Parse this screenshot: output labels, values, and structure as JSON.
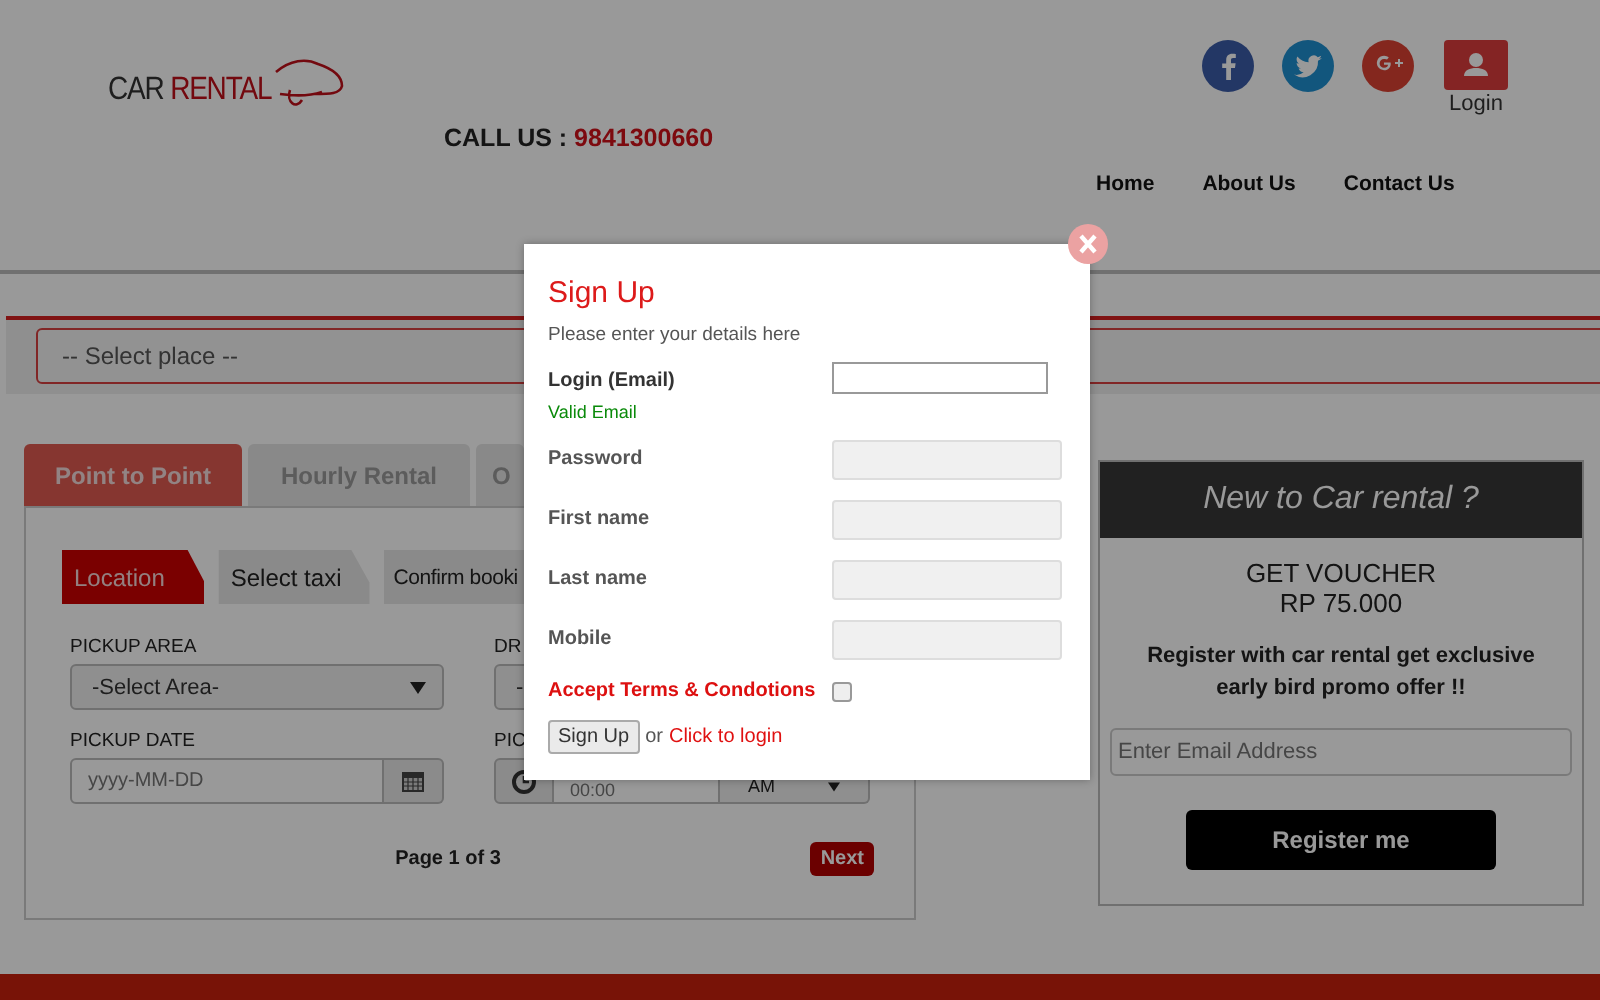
{
  "header": {
    "logo": {
      "word_1": "CAR",
      "word_2": "RENTAL"
    },
    "call_us": {
      "label": "CALL US :",
      "number": "9841300660"
    },
    "login_label": "Login"
  },
  "nav": [
    {
      "label": "Home"
    },
    {
      "label": "About Us"
    },
    {
      "label": "Contact Us"
    }
  ],
  "place_select": {
    "value": "-- Select place --"
  },
  "tabs": [
    {
      "label": "Point to Point",
      "selected": true
    },
    {
      "label": "Hourly Rental",
      "selected": false
    },
    {
      "label": "O",
      "selected": false
    }
  ],
  "steps": [
    {
      "label": "Location",
      "selected": true
    },
    {
      "label": "Select taxi",
      "selected": false
    },
    {
      "label": "Confirm booki",
      "selected": false
    }
  ],
  "form": {
    "pickup_area": {
      "label": "PICKUP AREA",
      "value": "-Select Area-"
    },
    "drop": {
      "label": "DR",
      "value": "-"
    },
    "pickup_date": {
      "label": "PICKUP DATE",
      "placeholder": "yyyy-MM-DD"
    },
    "pickup_time": {
      "label": "PIC",
      "placeholder": "00:00",
      "period": "AM"
    }
  },
  "pager": {
    "text": "Page 1 of 3",
    "next": "Next"
  },
  "promo": {
    "title": "New to Car rental ?",
    "voucher": "GET VOUCHER",
    "amount": "RP 75.000",
    "text": "Register with car rental get exclusive early bird promo offer !!",
    "email_placeholder": "Enter Email Address",
    "button": "Register me"
  },
  "modal": {
    "title": "Sign Up",
    "subtitle": "Please enter your details here",
    "fields": [
      {
        "label": "Login (Email)",
        "hint": "Valid Email",
        "focused": true
      },
      {
        "label": "Password",
        "focused": false
      },
      {
        "label": "First name",
        "focused": false
      },
      {
        "label": "Last name",
        "focused": false
      },
      {
        "label": "Mobile",
        "focused": false
      }
    ],
    "terms": {
      "label": "Accept Terms & Condotions",
      "checked": false
    },
    "submit": "Sign Up",
    "or": "or",
    "login_link": "Click to login"
  }
}
